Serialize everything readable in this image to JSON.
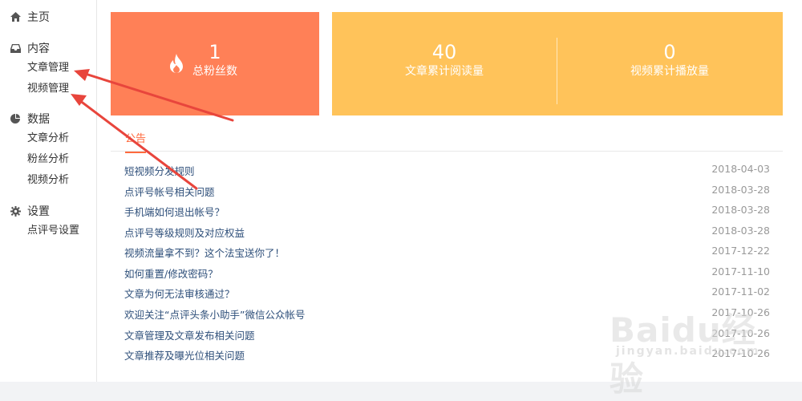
{
  "sidebar": {
    "home": "主页",
    "content": {
      "title": "内容",
      "items": [
        "文章管理",
        "视频管理"
      ]
    },
    "data": {
      "title": "数据",
      "items": [
        "文章分析",
        "粉丝分析",
        "视频分析"
      ]
    },
    "settings": {
      "title": "设置",
      "items": [
        "点评号设置"
      ]
    }
  },
  "cards": {
    "fans": {
      "value": "1",
      "label": "总粉丝数",
      "icon": "fire-icon"
    },
    "article_reads": {
      "value": "40",
      "label": "文章累计阅读量"
    },
    "video_plays": {
      "value": "0",
      "label": "视频累计播放量"
    }
  },
  "tab": {
    "label": "公告"
  },
  "notices": [
    {
      "title": "短视频分发规则",
      "date": "2018-04-03"
    },
    {
      "title": "点评号帐号相关问题",
      "date": "2018-03-28"
    },
    {
      "title": "手机端如何退出帐号？",
      "date": "2018-03-28"
    },
    {
      "title": "点评号等级规则及对应权益",
      "date": "2018-03-28"
    },
    {
      "title": "视频流量拿不到？这个法宝送你了！",
      "date": "2017-12-22"
    },
    {
      "title": "如何重置/修改密码？",
      "date": "2017-11-10"
    },
    {
      "title": "文章为何无法审核通过？",
      "date": "2017-11-02"
    },
    {
      "title": "欢迎关注“点评头条小助手”微信公众帐号",
      "date": "2017-10-26"
    },
    {
      "title": "文章管理及文章发布相关问题",
      "date": "2017-10-26"
    },
    {
      "title": "文章推荐及曝光位相关问题",
      "date": "2017-10-26"
    }
  ],
  "watermark": {
    "logo": "Baidu经验",
    "url": "jingyan.baidu.com"
  },
  "colors": {
    "orange_card": "#ff8057",
    "yellow_card": "#ffc35a",
    "accent": "#ff6a3d",
    "link": "#2e4f7a",
    "arrow": "#e8453c"
  }
}
